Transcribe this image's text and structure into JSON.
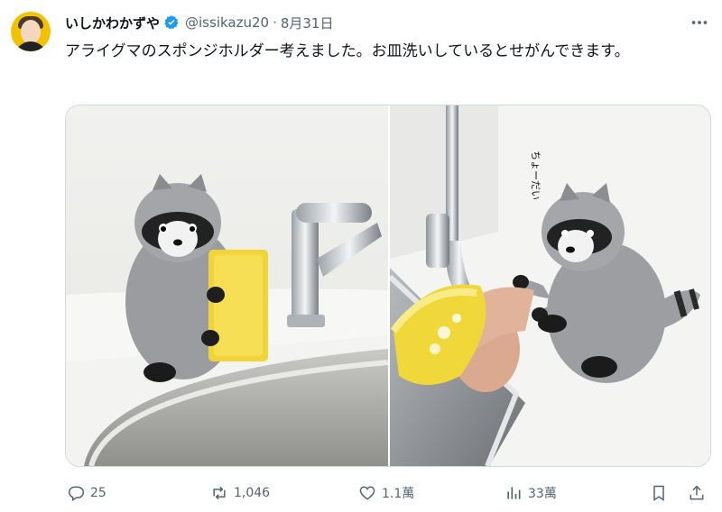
{
  "user": {
    "display_name": "いしかわかずや",
    "handle": "@issikazu20",
    "separator": "·",
    "date": "8月31日"
  },
  "tweet": {
    "text": "アライグマのスポンジホルダー考えました。お皿洗いしているとせがんできます。"
  },
  "media": {
    "right_image_caption": "ちょーだい"
  },
  "actions": {
    "replies": "25",
    "retweets": "1,046",
    "likes": "1.1萬",
    "views": "33萬"
  },
  "colors": {
    "verified": "#1d9bf0",
    "muted": "#536471",
    "text": "#0f1419",
    "border": "#cfd9de"
  },
  "icons": [
    "verified-badge-icon",
    "more-icon",
    "reply-icon",
    "retweet-icon",
    "like-icon",
    "views-icon",
    "bookmark-icon",
    "share-icon"
  ]
}
